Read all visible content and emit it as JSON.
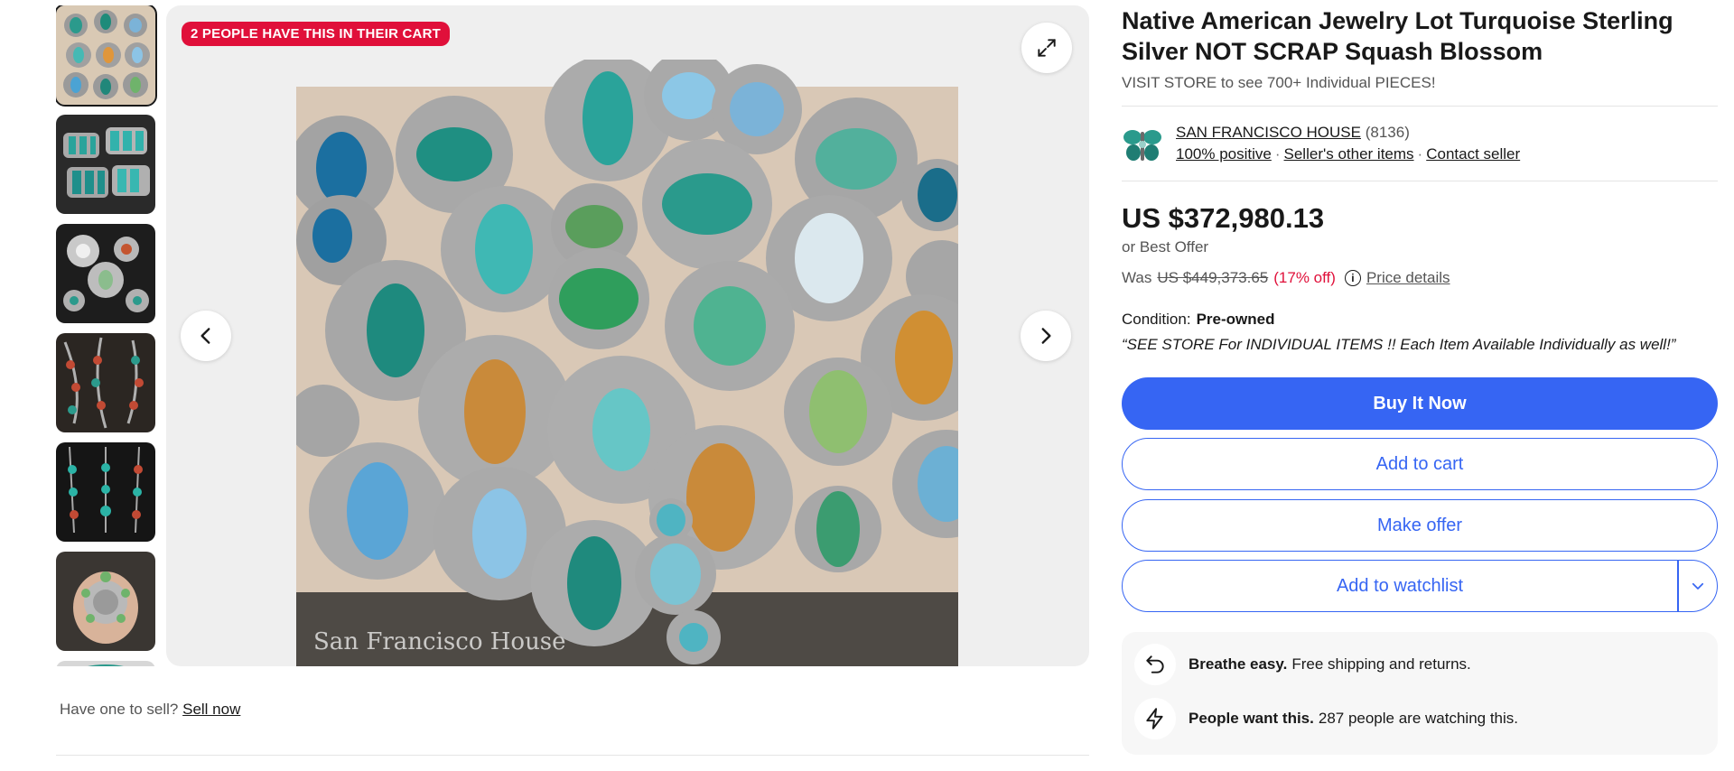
{
  "gallery": {
    "badge": "2 PEOPLE HAVE THIS IN THEIR CART",
    "watermark": "San Francisco House",
    "thumbnails": [
      "thumbnail-1",
      "thumbnail-2",
      "thumbnail-3",
      "thumbnail-4",
      "thumbnail-5",
      "thumbnail-6",
      "thumbnail-7"
    ],
    "icons": {
      "expand": "expand-icon",
      "prev": "chevron-left-icon",
      "next": "chevron-right-icon"
    }
  },
  "sell": {
    "prompt": "Have one to sell?",
    "link": "Sell now"
  },
  "listing": {
    "title": "Native American Jewelry Lot Turquoise Sterling Silver NOT SCRAP Squash Blossom",
    "subtitle": "VISIT STORE to see 700+ Individual PIECES!"
  },
  "seller": {
    "name": "SAN FRANCISCO HOUSE",
    "feedback_count": "(8136)",
    "positive": "100% positive",
    "other_items": "Seller's other items",
    "contact": "Contact seller",
    "separator": "·"
  },
  "pricing": {
    "price": "US $372,980.13",
    "best_offer": "or Best Offer",
    "was_label": "Was",
    "was_price": "US $449,373.65",
    "discount": "(17% off)",
    "details_link": "Price details",
    "info_icon": "i"
  },
  "condition": {
    "label": "Condition:",
    "value": "Pre-owned",
    "quote": "“SEE STORE For INDIVIDUAL ITEMS !! Each Item Available Individually as well!”"
  },
  "actions": {
    "buy": "Buy It Now",
    "cart": "Add to cart",
    "offer": "Make offer",
    "watchlist": "Add to watchlist"
  },
  "perks": [
    {
      "bold": "Breathe easy.",
      "text": "Free shipping and returns.",
      "icon": "returns-icon"
    },
    {
      "bold": "People want this.",
      "text": "287 people are watching this.",
      "icon": "lightning-icon"
    }
  ],
  "colors": {
    "accent": "#3665f3",
    "badge": "#e0103a",
    "discount": "#e0103a",
    "text": "#191919",
    "muted": "#555555"
  }
}
